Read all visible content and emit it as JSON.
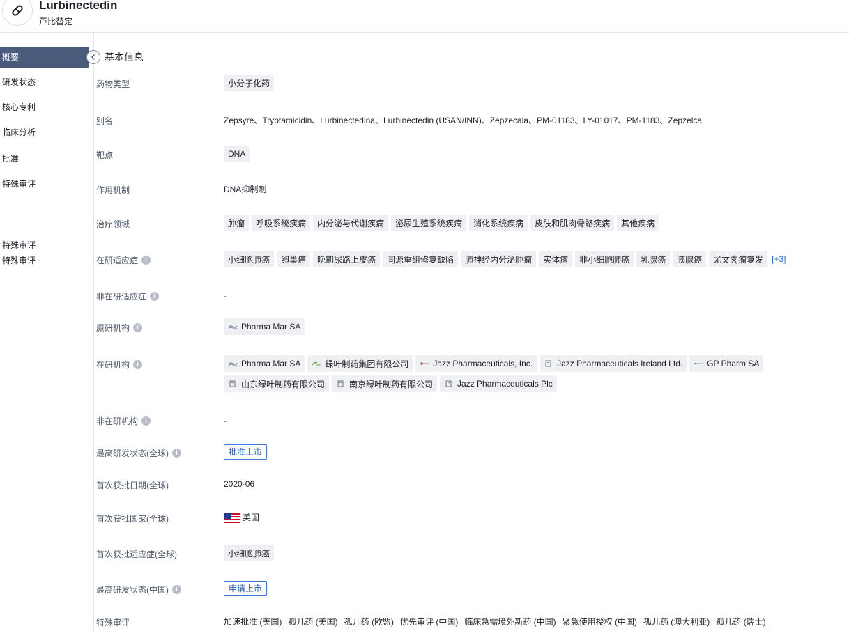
{
  "header": {
    "title": "Lurbinectedin",
    "subtitle": "芦比替定"
  },
  "sidebar": {
    "items": [
      {
        "label": "概要"
      },
      {
        "label": "研发状态"
      },
      {
        "label": "核心专利"
      },
      {
        "label": "临床分析"
      },
      {
        "label": "批准"
      },
      {
        "label": "特殊审评"
      },
      {
        "label": "特殊审评"
      },
      {
        "label": "特殊审评"
      }
    ]
  },
  "section": {
    "title": "基本信息"
  },
  "fields": {
    "drug_type": {
      "label": "药物类型",
      "tags": [
        "小分子化药"
      ]
    },
    "alias": {
      "label": "别名",
      "value": "Zepsyre、Tryptamicidin、Lurbinectedina、Lurbinectedin (USAN/INN)、Zepzecala、PM-01183、LY-01017、PM-1183、Zepzelca"
    },
    "target": {
      "label": "靶点",
      "tags": [
        "DNA"
      ]
    },
    "mechanism": {
      "label": "作用机制",
      "value": "DNA抑制剂"
    },
    "therapeutic_area": {
      "label": "治疗领域",
      "tags": [
        "肿瘤",
        "呼吸系统疾病",
        "内分泌与代谢疾病",
        "泌尿生殖系统疾病",
        "消化系统疾病",
        "皮肤和肌肉骨骼疾病",
        "其他疾病"
      ]
    },
    "active_indication": {
      "label": "在研适应症",
      "tags": [
        "小细胞肺癌",
        "卵巢癌",
        "晚期尿路上皮癌",
        "同源重组修复缺陷",
        "肺神经内分泌肿瘤",
        "实体瘤",
        "非小细胞肺癌",
        "乳腺癌",
        "胰腺癌",
        "尤文肉瘤复发"
      ],
      "more": "[+3]"
    },
    "inactive_indication": {
      "label": "非在研适应症",
      "value": "-"
    },
    "originator": {
      "label": "原研机构",
      "orgs": [
        "Pharma Mar SA"
      ]
    },
    "active_orgs": {
      "label": "在研机构",
      "orgs_row1": [
        "Pharma Mar SA",
        "绿叶制药集团有限公司",
        "Jazz Pharmaceuticals, Inc.",
        "Jazz Pharmaceuticals Ireland Ltd.",
        "GP Pharm SA"
      ],
      "orgs_row2": [
        "山东绿叶制药有限公司",
        "南京绿叶制药有限公司",
        "Jazz Pharmaceuticals Plc"
      ]
    },
    "inactive_orgs": {
      "label": "非在研机构",
      "value": "-"
    },
    "highest_phase_global": {
      "label": "最高研发状态(全球)",
      "value": "批准上市"
    },
    "first_approval_date": {
      "label": "首次获批日期(全球)",
      "value": "2020-06"
    },
    "first_approval_country": {
      "label": "首次获批国家(全球)",
      "value": "美国",
      "flag": "us-flag-icon"
    },
    "first_approval_indication": {
      "label": "首次获批适应症(全球)",
      "tags": [
        "小细胞肺癌"
      ]
    },
    "highest_phase_china": {
      "label": "最高研发状态(中国)",
      "value": "申请上市"
    },
    "special_review": {
      "label": "特殊审评",
      "items": [
        "加速批准 (美国)",
        "孤儿药 (美国)",
        "孤儿药 (欧盟)",
        "优先审评 (中国)",
        "临床急需境外新药 (中国)",
        "紧急使用授权 (中国)",
        "孤儿药 (澳大利亚)",
        "孤儿药 (瑞士)"
      ]
    }
  },
  "colors": {
    "active_nav": "#4a5a7a",
    "badge_blue": "#3f78d9",
    "link_blue": "#1f6fe5",
    "tag_bg": "#eef0f3"
  }
}
